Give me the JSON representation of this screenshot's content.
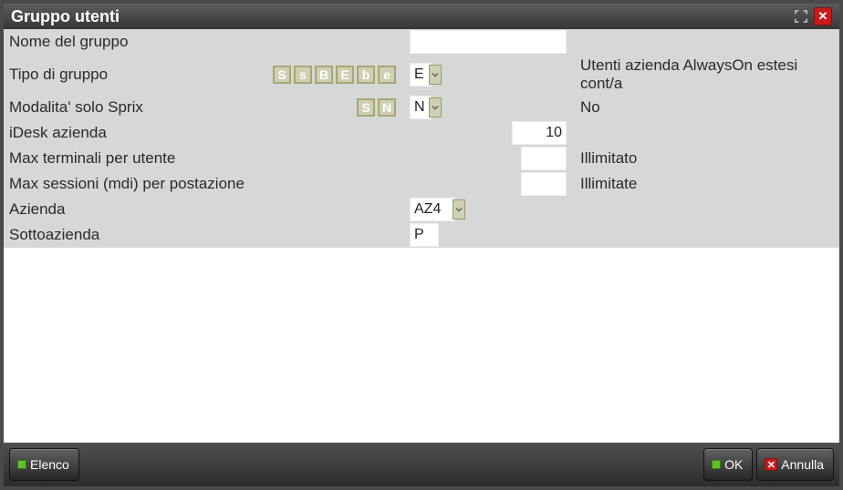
{
  "window": {
    "title": "Gruppo utenti"
  },
  "form": {
    "nome_gruppo": {
      "label": "Nome del gruppo",
      "value": ""
    },
    "tipo_gruppo": {
      "label": "Tipo di gruppo",
      "chips": [
        "S",
        "s",
        "B",
        "E",
        "b",
        "e"
      ],
      "value": "E",
      "desc": "Utenti azienda AlwaysOn estesi cont/a"
    },
    "modalita_sprix": {
      "label": "Modalita' solo Sprix",
      "chips": [
        "S",
        "N"
      ],
      "value": "N",
      "desc": "No"
    },
    "idesk": {
      "label": "iDesk azienda",
      "value": "10"
    },
    "max_term": {
      "label": "Max terminali per utente",
      "value": "",
      "desc": "Illimitato"
    },
    "max_sess": {
      "label": "Max sessioni (mdi) per postazione",
      "value": "",
      "desc": "Illimitate"
    },
    "azienda": {
      "label": "Azienda",
      "value": "AZ4"
    },
    "sottoazienda": {
      "label": "Sottoazienda",
      "value": "P"
    }
  },
  "footer": {
    "elenco": "Elenco",
    "ok": "OK",
    "annulla": "Annulla"
  }
}
